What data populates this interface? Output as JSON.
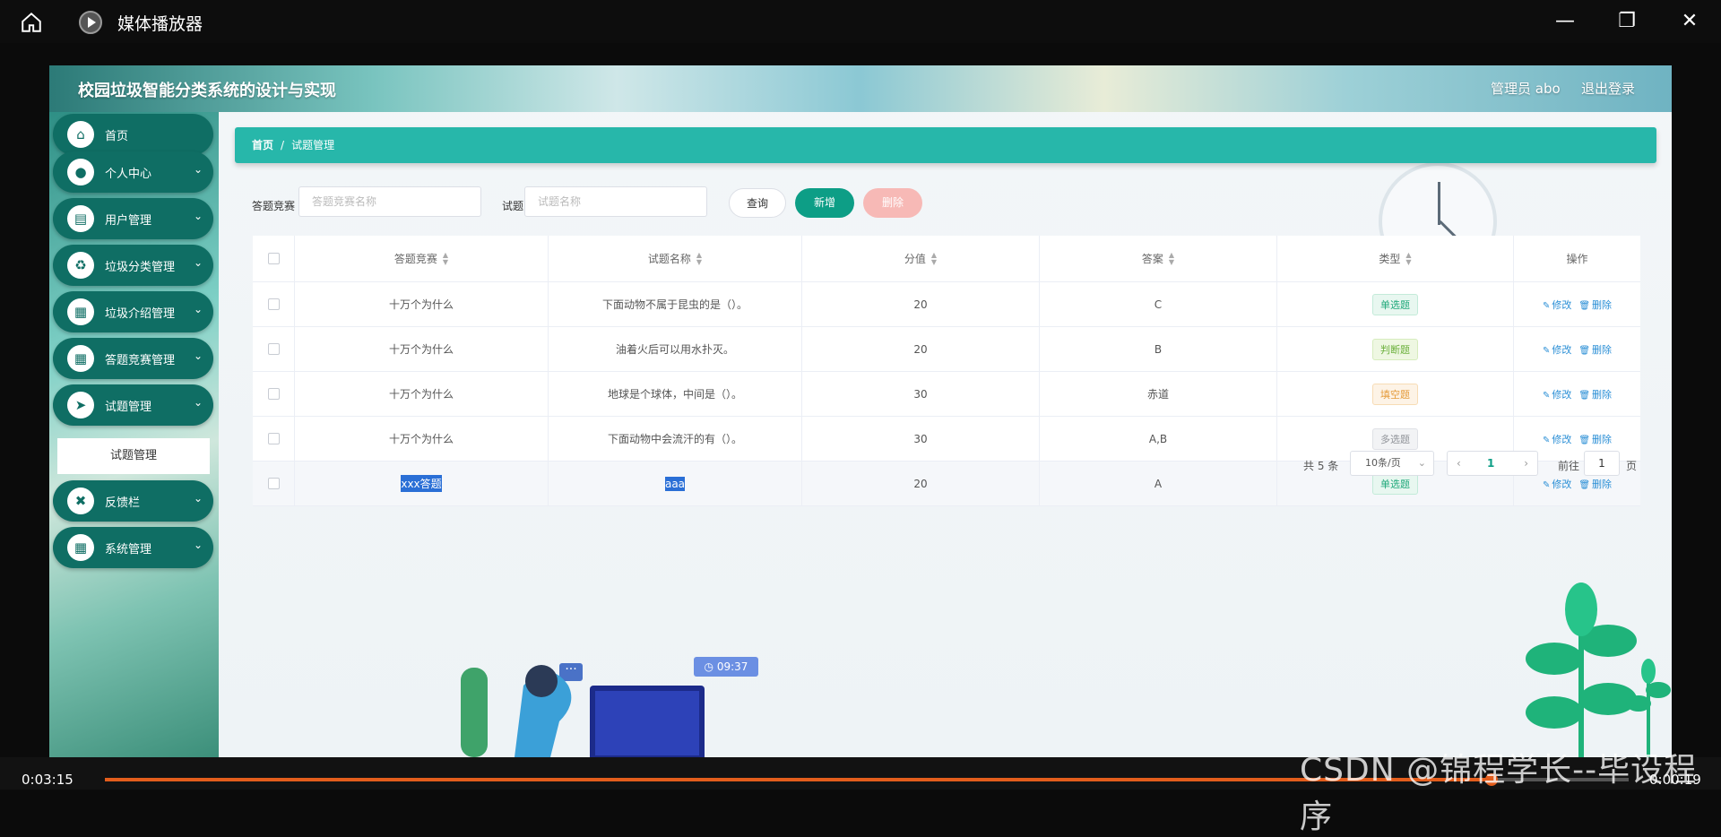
{
  "window": {
    "title": "媒体播放器",
    "icons": {
      "home": "home-icon",
      "app": "media-player-icon",
      "minimize": "minimize-icon",
      "maximize": "maximize-icon",
      "close": "close-icon"
    }
  },
  "app": {
    "title": "校园垃圾智能分类系统的设计与实现",
    "user": "管理员 abo",
    "logout": "退出登录"
  },
  "sidebar": {
    "items": [
      {
        "label": "首页",
        "icon": "home-icon"
      },
      {
        "label": "个人中心",
        "icon": "user-icon"
      },
      {
        "label": "用户管理",
        "icon": "briefcase-icon"
      },
      {
        "label": "垃圾分类管理",
        "icon": "recycle-icon"
      },
      {
        "label": "垃圾介绍管理",
        "icon": "grid-icon"
      },
      {
        "label": "答题竞赛管理",
        "icon": "grid-icon"
      },
      {
        "label": "试题管理",
        "icon": "send-icon"
      },
      {
        "label": "反馈栏",
        "icon": "ticket-icon"
      },
      {
        "label": "系统管理",
        "icon": "grid-icon"
      }
    ],
    "submenu": "试题管理"
  },
  "breadcrumb": {
    "home": "首页",
    "separator": "/",
    "current": "试题管理"
  },
  "search": {
    "competition_label": "答题竞赛",
    "competition_placeholder": "答题竞赛名称",
    "question_label": "试题",
    "question_placeholder": "试题名称",
    "query": "查询",
    "add": "新增",
    "delete": "删除"
  },
  "table": {
    "headers": [
      "答题竞赛",
      "试题名称",
      "分值",
      "答案",
      "类型",
      "操作"
    ],
    "rows": [
      {
        "competition": "十万个为什么",
        "name": "下面动物不属于昆虫的是（）。",
        "score": "20",
        "answer": "C",
        "type": "单选题"
      },
      {
        "competition": "十万个为什么",
        "name": "油着火后可以用水扑灭。",
        "score": "20",
        "answer": "B",
        "type": "判断题"
      },
      {
        "competition": "十万个为什么",
        "name": "地球是个球体，中间是（）。",
        "score": "30",
        "answer": "赤道",
        "type": "填空题"
      },
      {
        "competition": "十万个为什么",
        "name": "下面动物中会流汗的有（）。",
        "score": "30",
        "answer": "A,B",
        "type": "多选题"
      },
      {
        "competition": "xxx答题",
        "name": "aaa",
        "score": "20",
        "answer": "A",
        "type": "单选题"
      }
    ],
    "op_edit": "修改",
    "op_delete": "删除"
  },
  "pagination": {
    "total": "共 5 条",
    "page_size": "10条/页",
    "current": "1",
    "goto": "前往",
    "goto_value": "1",
    "page_suffix": "页"
  },
  "illustration": {
    "timer": "09:37"
  },
  "player": {
    "elapsed": "0:03:15",
    "remaining": "0:00:19",
    "progress": 0.91,
    "watermark": "CSDN @锦程学长--毕设程序"
  },
  "colors": {
    "accent": "#27b7aa",
    "primary_button": "#0d9e86",
    "danger_button": "#f7b9b6",
    "progress": "#e35d1c"
  }
}
